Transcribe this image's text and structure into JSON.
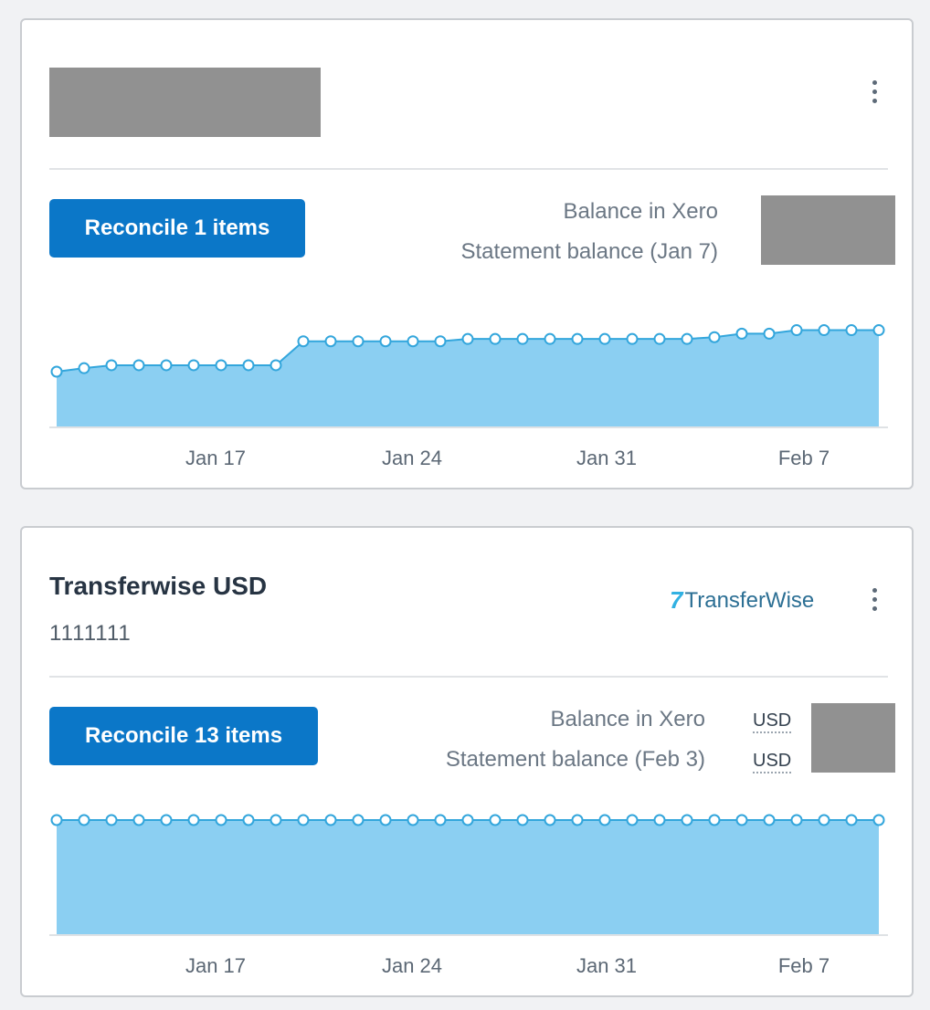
{
  "cards": [
    {
      "name": "",
      "account_number": "",
      "reconcile_label": "Reconcile 1 items",
      "balance_in_xero_label": "Balance in Xero",
      "statement_balance_label": "Statement balance (Jan 7)",
      "chart_data": {
        "type": "area",
        "x_ticks": [
          "Jan 17",
          "Jan 24",
          "Jan 31",
          "Feb 7"
        ],
        "values": [
          0,
          0.06,
          0.11,
          0.11,
          0.11,
          0.11,
          0.11,
          0.11,
          0.11,
          0.52,
          0.52,
          0.52,
          0.52,
          0.52,
          0.52,
          0.56,
          0.56,
          0.56,
          0.56,
          0.56,
          0.56,
          0.56,
          0.56,
          0.56,
          0.59,
          0.65,
          0.65,
          0.71,
          0.71,
          0.71,
          0.71
        ],
        "point_count": 31,
        "area_color": "#8bcff2",
        "line_color": "#33a6dc"
      }
    },
    {
      "name": "Transferwise USD",
      "account_number": "1111111",
      "logo_text": "TransferWise",
      "logo_mark": "7",
      "reconcile_label": "Reconcile 13 items",
      "balance_in_xero_label": "Balance in Xero",
      "statement_balance_label": "Statement balance (Feb 3)",
      "currency_1": "USD",
      "currency_2": "USD",
      "chart_data": {
        "type": "area",
        "x_ticks": [
          "Jan 17",
          "Jan 24",
          "Jan 31",
          "Feb 7"
        ],
        "values": [
          1,
          1,
          1,
          1,
          1,
          1,
          1,
          1,
          1,
          1,
          1,
          1,
          1,
          1,
          1,
          1,
          1,
          1,
          1,
          1,
          1,
          1,
          1,
          1,
          1,
          1,
          1,
          1,
          1,
          1,
          1
        ],
        "point_count": 31,
        "area_color": "#8bcff2",
        "line_color": "#33a6dc"
      }
    }
  ],
  "colors": {
    "button": "#0b77c8",
    "redacted": "#919191",
    "background": "#f1f2f4"
  }
}
